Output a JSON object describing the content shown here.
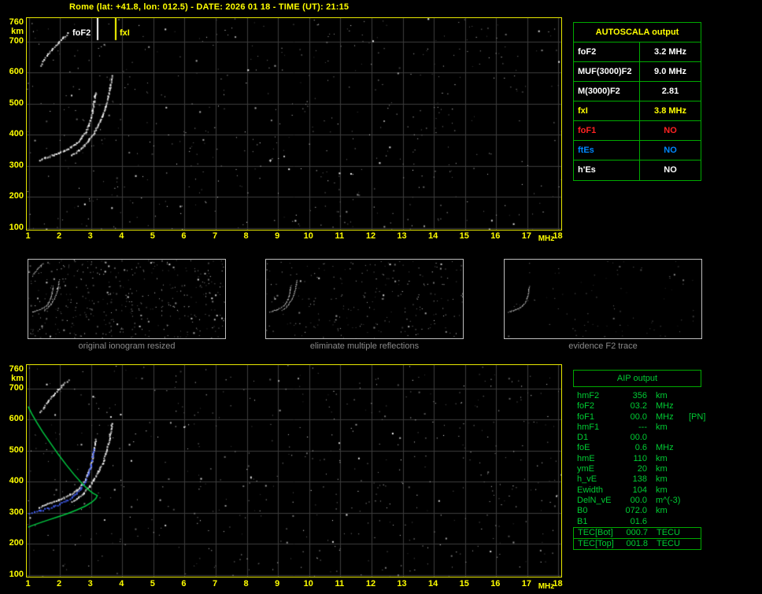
{
  "title": "Rome (lat: +41.8, lon: 012.5) - DATE: 2026 01 18 - TIME (UT): 21:15",
  "colors": {
    "background": "#000000",
    "axis_text": "#ffff00",
    "panel_border": "#e8e800",
    "grid": "#3d3d3d",
    "table_border": "#00aa00",
    "aip_text": "#00cc33",
    "trace_white": "#ffffff",
    "trace_blue": "#3f5fff",
    "profile_green": "#00c840",
    "caption_gray": "#8a8a8a"
  },
  "ionogram": {
    "x_ticks": [
      1,
      2,
      3,
      4,
      5,
      6,
      7,
      8,
      9,
      10,
      11,
      12,
      13,
      14,
      15,
      16,
      17,
      18
    ],
    "x_unit": "MHz",
    "y_ticks": [
      760,
      700,
      600,
      500,
      400,
      300,
      200,
      100
    ],
    "y_unit": "km",
    "markers": [
      {
        "label": "foF2",
        "freq": 3.2,
        "color": "#ffffff"
      },
      {
        "label": "fxI",
        "freq": 3.8,
        "color": "#ffff00"
      }
    ],
    "traces": {
      "f2_ordinary": [
        [
          1.35,
          318
        ],
        [
          1.55,
          326
        ],
        [
          1.75,
          333
        ],
        [
          1.95,
          340
        ],
        [
          2.15,
          348
        ],
        [
          2.35,
          358
        ],
        [
          2.55,
          372
        ],
        [
          2.7,
          388
        ],
        [
          2.82,
          406
        ],
        [
          2.92,
          428
        ],
        [
          3.0,
          452
        ],
        [
          3.06,
          478
        ],
        [
          3.1,
          505
        ],
        [
          3.13,
          522
        ],
        [
          3.15,
          535
        ]
      ],
      "f2_extraordinary": [
        [
          2.4,
          335
        ],
        [
          2.6,
          348
        ],
        [
          2.78,
          364
        ],
        [
          2.95,
          384
        ],
        [
          3.1,
          406
        ],
        [
          3.25,
          432
        ],
        [
          3.38,
          460
        ],
        [
          3.48,
          490
        ],
        [
          3.56,
          520
        ],
        [
          3.62,
          552
        ],
        [
          3.67,
          588
        ]
      ],
      "second_reflection": [
        [
          1.38,
          622
        ],
        [
          1.5,
          640
        ],
        [
          1.62,
          658
        ],
        [
          1.78,
          676
        ],
        [
          1.95,
          695
        ],
        [
          2.12,
          712
        ],
        [
          2.28,
          726
        ]
      ],
      "restored_trace": [
        [
          1.02,
          296
        ],
        [
          1.2,
          301
        ],
        [
          1.4,
          307
        ],
        [
          1.6,
          313
        ],
        [
          1.8,
          320
        ],
        [
          2.0,
          328
        ],
        [
          2.2,
          338
        ],
        [
          2.4,
          350
        ],
        [
          2.55,
          363
        ],
        [
          2.7,
          380
        ],
        [
          2.82,
          400
        ],
        [
          2.92,
          424
        ],
        [
          3.0,
          450
        ],
        [
          3.06,
          478
        ],
        [
          3.1,
          505
        ]
      ],
      "density_profile": [
        [
          0.98,
          642
        ],
        [
          1.1,
          618
        ],
        [
          1.25,
          592
        ],
        [
          1.45,
          560
        ],
        [
          1.7,
          524
        ],
        [
          1.95,
          488
        ],
        [
          2.2,
          455
        ],
        [
          2.45,
          424
        ],
        [
          2.68,
          398
        ],
        [
          2.88,
          378
        ],
        [
          3.05,
          364
        ],
        [
          3.18,
          357
        ],
        [
          3.2,
          356
        ],
        [
          3.15,
          346
        ],
        [
          3.02,
          334
        ],
        [
          2.82,
          322
        ],
        [
          2.55,
          310
        ],
        [
          2.25,
          298
        ],
        [
          1.95,
          288
        ],
        [
          1.65,
          278
        ],
        [
          1.35,
          268
        ],
        [
          1.1,
          259
        ],
        [
          0.98,
          254
        ]
      ]
    }
  },
  "autoscala": {
    "title": "AUTOSCALA output",
    "rows": [
      {
        "label": "foF2",
        "value": "3.2 MHz",
        "color": "#ffffff"
      },
      {
        "label": "MUF(3000)F2",
        "value": "9.0 MHz",
        "color": "#ffffff"
      },
      {
        "label": "M(3000)F2",
        "value": "2.81",
        "color": "#ffffff"
      },
      {
        "label": "fxI",
        "value": "3.8 MHz",
        "color": "#ffff00"
      },
      {
        "label": "foF1",
        "value": "NO",
        "color": "#ff2222"
      },
      {
        "label": "ftEs",
        "value": "NO",
        "color": "#0088ff"
      },
      {
        "label": "h'Es",
        "value": "NO",
        "color": "#ffffff"
      }
    ]
  },
  "thumbnails": [
    {
      "caption": "original ionogram resized",
      "traces": [
        "f2_ordinary",
        "f2_extraordinary",
        "second_reflection"
      ],
      "noise": 420,
      "seed": 11
    },
    {
      "caption": "eliminate multiple reflections",
      "traces": [
        "f2_ordinary",
        "f2_extraordinary"
      ],
      "noise": 240,
      "seed": 22
    },
    {
      "caption": "evidence F2 trace",
      "traces": [
        "f2_ordinary"
      ],
      "noise": 90,
      "seed": 33
    }
  ],
  "aip": {
    "title": "AIP output",
    "rows": [
      {
        "label": "hmF2",
        "value": "356",
        "unit": "km",
        "note": ""
      },
      {
        "label": "foF2",
        "value": "03.2",
        "unit": "MHz",
        "note": ""
      },
      {
        "label": "foF1",
        "value": "00.0",
        "unit": "MHz",
        "note": "[PN]"
      },
      {
        "label": "hmF1",
        "value": "---",
        "unit": "km",
        "note": ""
      },
      {
        "label": "D1",
        "value": "00.0",
        "unit": "",
        "note": ""
      },
      {
        "label": "foE",
        "value": "0.6",
        "unit": "MHz",
        "note": ""
      },
      {
        "label": "hmE",
        "value": "110",
        "unit": "km",
        "note": ""
      },
      {
        "label": "ymE",
        "value": "20",
        "unit": "km",
        "note": ""
      },
      {
        "label": "h_vE",
        "value": "138",
        "unit": "km",
        "note": ""
      },
      {
        "label": "Ewidth",
        "value": "104",
        "unit": "km",
        "note": ""
      },
      {
        "label": "DelN_vE",
        "value": "00.0",
        "unit": "m^(-3)",
        "note": ""
      },
      {
        "label": "B0",
        "value": "072.0",
        "unit": "km",
        "note": ""
      },
      {
        "label": "B1",
        "value": "01.6",
        "unit": "",
        "note": ""
      }
    ],
    "tec_rows": [
      {
        "label": "TEC[Bot]",
        "value": "000.7",
        "unit": "TECU"
      },
      {
        "label": "TEC[Top]",
        "value": "001.8",
        "unit": "TECU"
      }
    ]
  },
  "panels": {
    "top": {
      "noise": 540,
      "seed": 7
    },
    "bottom": {
      "noise": 540,
      "seed": 8
    }
  }
}
